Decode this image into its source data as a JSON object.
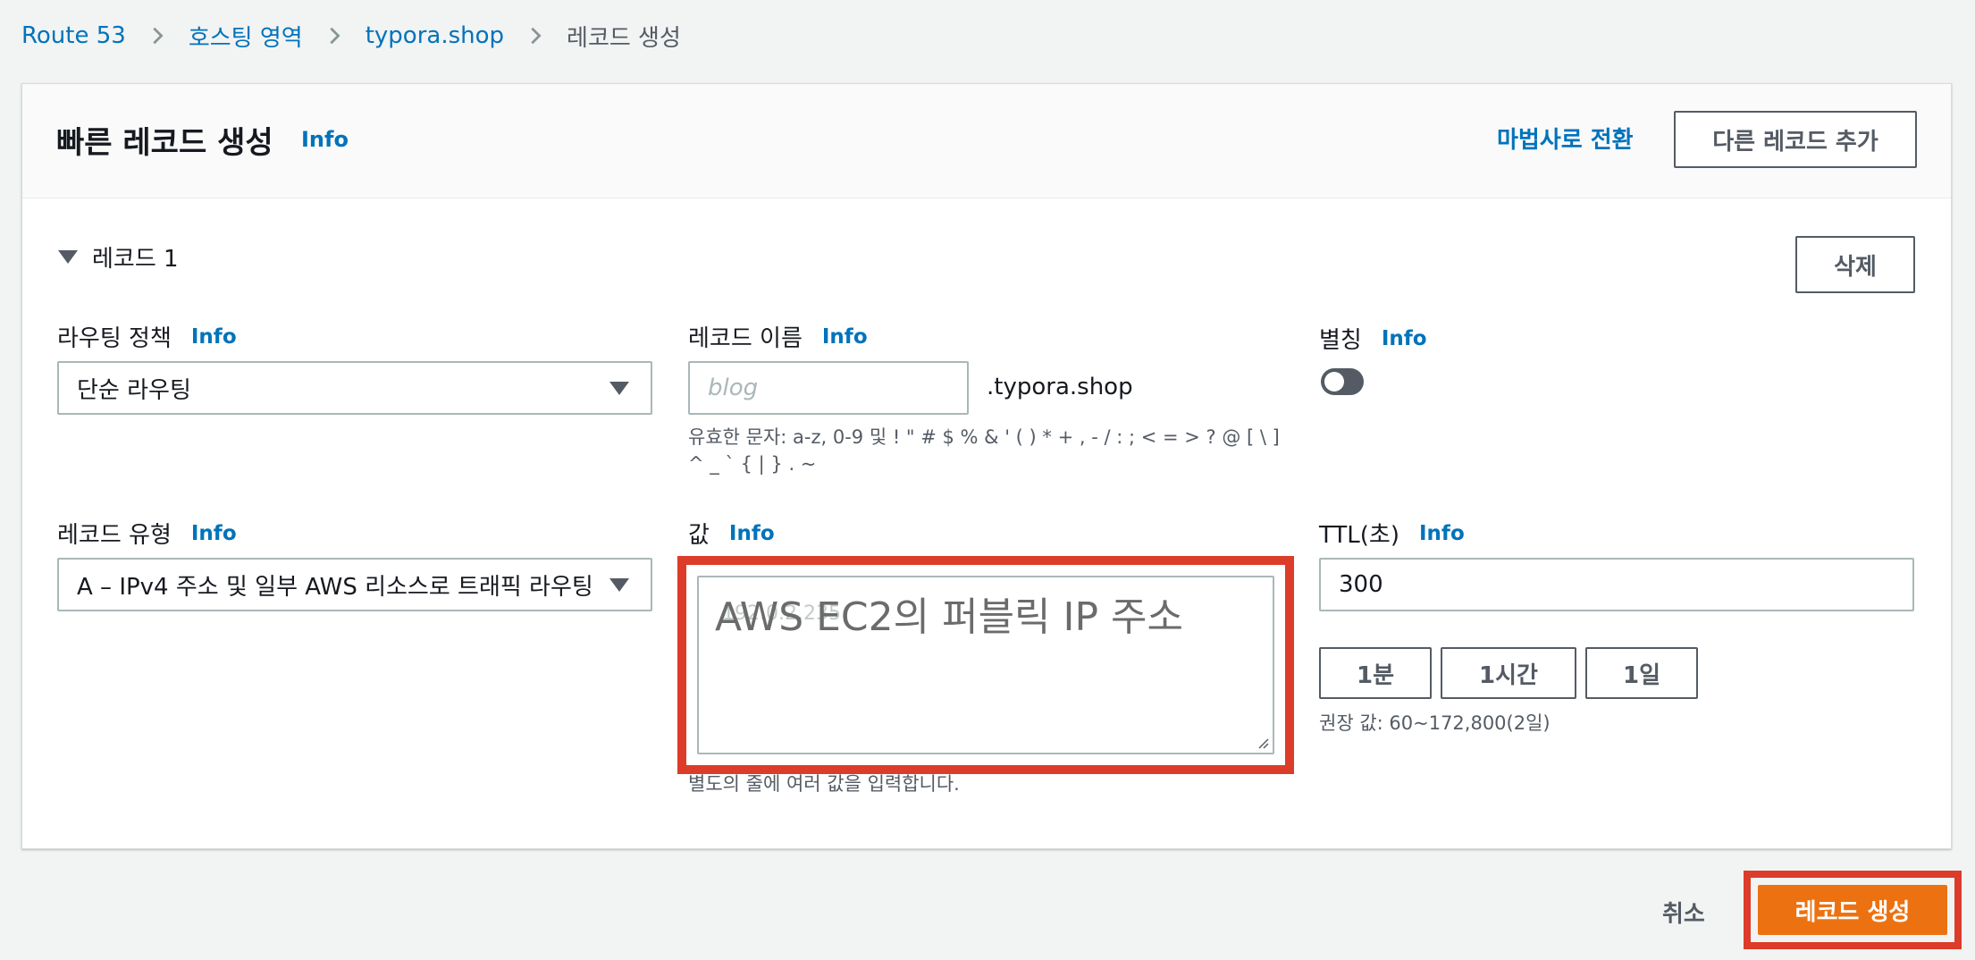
{
  "breadcrumb": {
    "items": [
      "Route 53",
      "호스팅 영역",
      "typora.shop"
    ],
    "current": "레코드 생성"
  },
  "header": {
    "title": "빠른 레코드 생성",
    "info": "Info",
    "wizard_link": "마법사로 전환",
    "add_record_button": "다른 레코드 추가"
  },
  "record": {
    "title": "레코드 1",
    "delete_button": "삭제",
    "routing_policy": {
      "label": "라우팅 정책",
      "info": "Info",
      "value": "단순 라우팅"
    },
    "record_name": {
      "label": "레코드 이름",
      "info": "Info",
      "placeholder": "blog",
      "suffix": ".typora.shop",
      "helper_line1": "유효한 문자: a-z, 0-9 및 ! \" # $ % & ' ( ) * + , - / : ; < = > ? @ [ \\ ]",
      "helper_line2": "^ _ ` { | } . ~"
    },
    "alias": {
      "label": "별칭",
      "info": "Info",
      "enabled": false
    },
    "record_type": {
      "label": "레코드 유형",
      "info": "Info",
      "value": "A – IPv4 주소 및 일부 AWS 리소스로 트래픽 라우팅"
    },
    "value": {
      "label": "값",
      "info": "Info",
      "placeholder": "192.0.2.235",
      "annotation": "AWS EC2의 퍼블릭 IP 주소",
      "helper": "별도의 줄에 여러 값을 입력합니다."
    },
    "ttl": {
      "label": "TTL(초)",
      "info": "Info",
      "value": "300",
      "presets": [
        "1분",
        "1시간",
        "1일"
      ],
      "helper": "권장 값: 60~172,800(2일)"
    }
  },
  "footer": {
    "cancel": "취소",
    "create": "레코드 생성"
  },
  "colors": {
    "link": "#0073bb",
    "primary": "#ec7211",
    "highlight": "#dc3c2a"
  }
}
